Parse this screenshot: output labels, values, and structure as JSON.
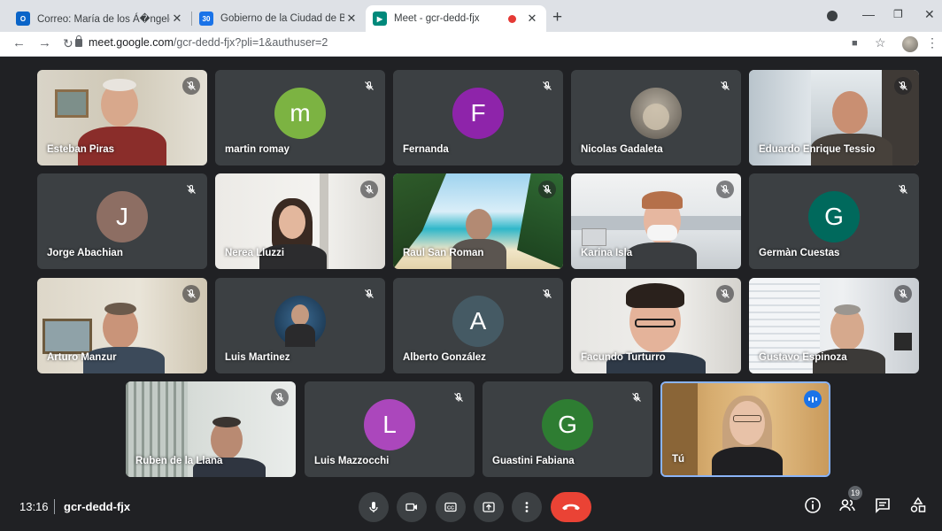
{
  "browser": {
    "tabs": [
      {
        "title": "Correo: María de los Á�ngeles C",
        "icon": "outlook-icon",
        "color": "#0a64c8"
      },
      {
        "title": "Gobierno de la Ciudad de Bueno",
        "icon": "calendar-icon",
        "color": "#1a73e8",
        "badge": "30"
      },
      {
        "title": "Meet - gcr-dedd-fjx",
        "icon": "meet-icon",
        "color": "#00897b"
      }
    ],
    "url_host": "meet.google.com",
    "url_path": "/gcr-dedd-fjx?pli=1&authuser=2"
  },
  "participants": [
    {
      "name": "Esteban Piras",
      "video": true
    },
    {
      "name": "martin romay",
      "initial": "m",
      "color": "#7cb342"
    },
    {
      "name": "Fernanda",
      "initial": "F",
      "color": "#8e24aa"
    },
    {
      "name": "Nicolas Gadaleta",
      "photo": true
    },
    {
      "name": "Eduardo Enrique Tessio",
      "video": true
    },
    {
      "name": "Jorge Abachian",
      "initial": "J",
      "color": "#8d6e63"
    },
    {
      "name": "Nerea Lluzzi",
      "video": true
    },
    {
      "name": "Raul San Roman",
      "video": true
    },
    {
      "name": "Karina Isla",
      "video": true
    },
    {
      "name": "Germàn Cuestas",
      "initial": "G",
      "color": "#00695c"
    },
    {
      "name": "Arturo Manzur",
      "video": true
    },
    {
      "name": "Luis Martinez",
      "photo": true
    },
    {
      "name": "Alberto González",
      "initial": "A",
      "color": "#455a64"
    },
    {
      "name": "Facundo Turturro",
      "video": true
    },
    {
      "name": "Gustavo Espinoza",
      "video": true
    },
    {
      "name": "Ruben de la Llana",
      "video": true
    },
    {
      "name": "Luis Mazzocchi",
      "initial": "L",
      "color": "#ab47bc"
    },
    {
      "name": "Guastini Fabiana",
      "initial": "G",
      "color": "#2e7d32"
    },
    {
      "name": "Tú",
      "video": true,
      "speaking": true
    }
  ],
  "bottom_bar": {
    "time": "13:16",
    "meeting_code": "gcr-dedd-fjx",
    "participant_count": "19"
  },
  "colors": {
    "end_call": "#ea4335",
    "active_border": "#8ab4f8",
    "background": "#202124",
    "tile": "#3c4043"
  }
}
